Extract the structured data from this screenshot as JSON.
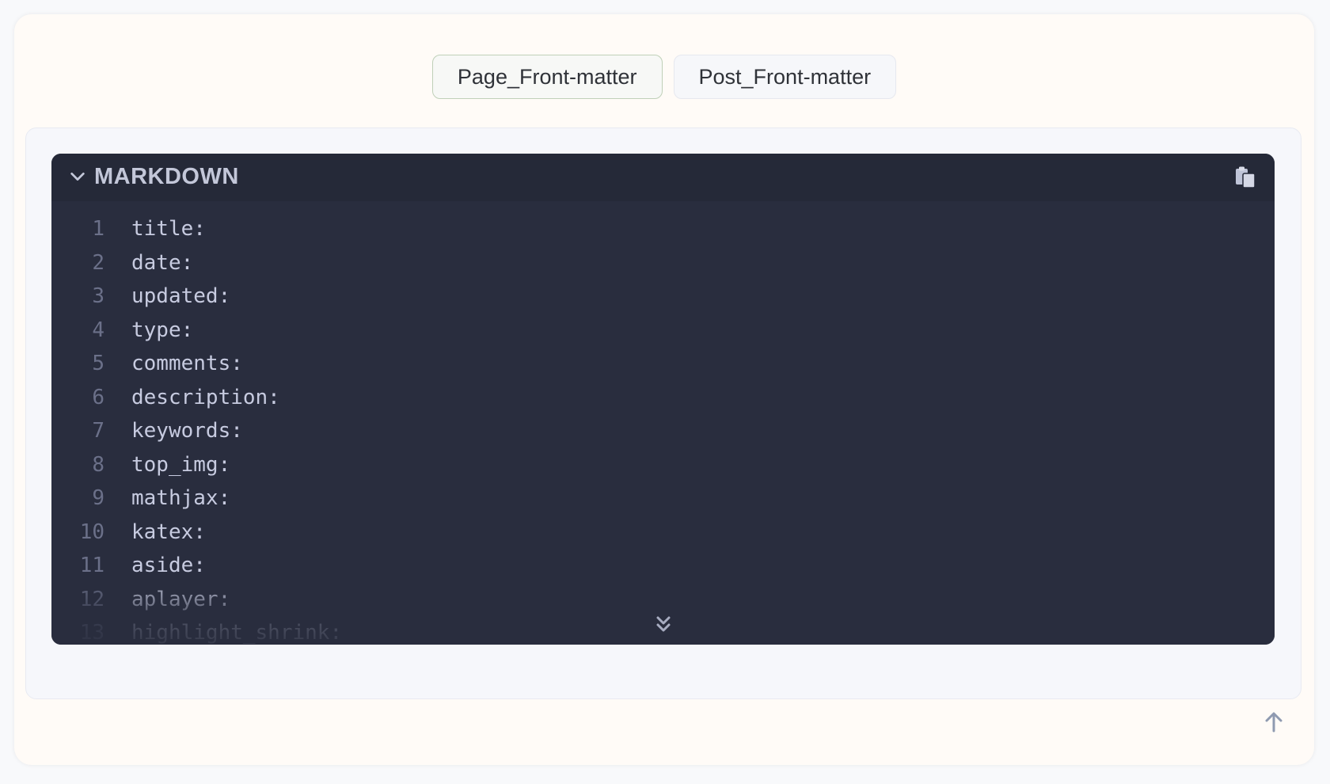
{
  "tabs": [
    {
      "label": "Page_Front-matter",
      "active": true
    },
    {
      "label": "Post_Front-matter",
      "active": false
    }
  ],
  "code_block": {
    "language": "MARKDOWN",
    "lines": [
      {
        "no": "1",
        "text": "title:"
      },
      {
        "no": "2",
        "text": "date:"
      },
      {
        "no": "3",
        "text": "updated:"
      },
      {
        "no": "4",
        "text": "type:"
      },
      {
        "no": "5",
        "text": "comments:"
      },
      {
        "no": "6",
        "text": "description:"
      },
      {
        "no": "7",
        "text": "keywords:"
      },
      {
        "no": "8",
        "text": "top_img:"
      },
      {
        "no": "9",
        "text": "mathjax:"
      },
      {
        "no": "10",
        "text": "katex:"
      },
      {
        "no": "11",
        "text": "aside:"
      },
      {
        "no": "12",
        "text": "aplayer:"
      },
      {
        "no": "13",
        "text": "highlight_shrink:"
      }
    ]
  },
  "icons": {
    "collapse": "chevron-down-icon",
    "copy": "copy-icon",
    "expand": "double-chevron-down-icon",
    "back_to_top": "arrow-up-icon"
  },
  "colors": {
    "code_background": "#292d3e",
    "code_header": "#252938",
    "page_background": "#fffbf7"
  }
}
